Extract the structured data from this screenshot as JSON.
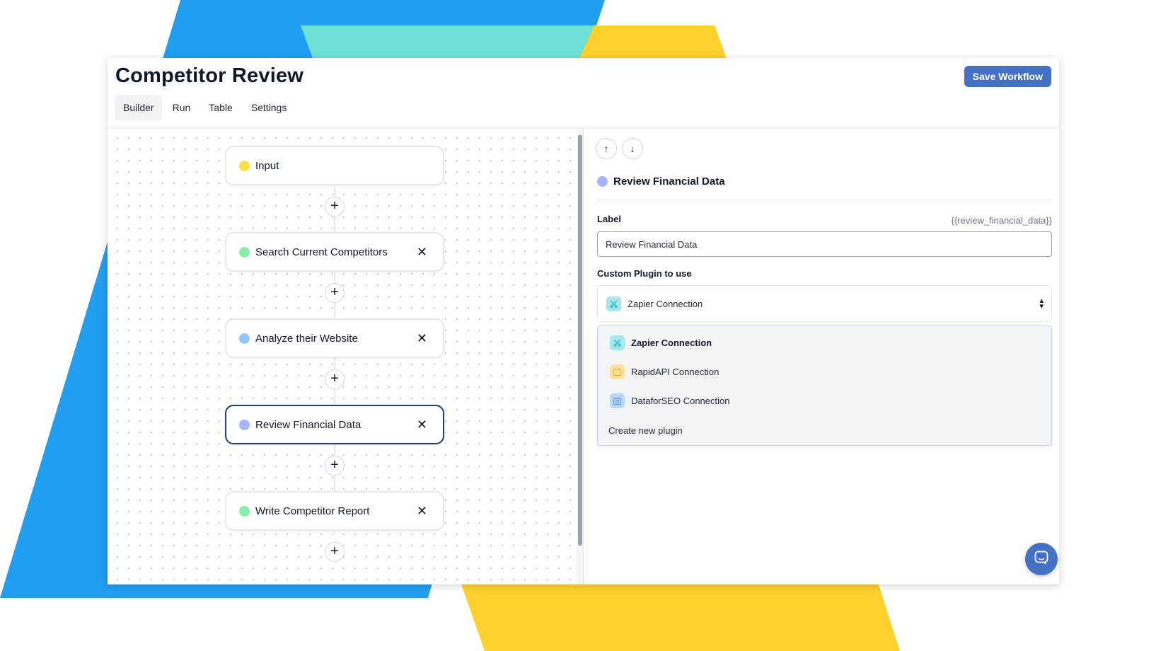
{
  "app": {
    "title": "Competitor Review",
    "save_label": "Save Workflow",
    "tabs": [
      {
        "label": "Builder",
        "active": true
      },
      {
        "label": "Run",
        "active": false
      },
      {
        "label": "Table",
        "active": false
      },
      {
        "label": "Settings",
        "active": false
      }
    ]
  },
  "canvas": {
    "nodes": [
      {
        "label": "Input",
        "color": "#fde047",
        "removable": false,
        "selected": false
      },
      {
        "label": "Search Current Competitors",
        "color": "#86efac",
        "removable": true,
        "selected": false
      },
      {
        "label": "Analyze their Website",
        "color": "#93c5fd",
        "removable": true,
        "selected": false
      },
      {
        "label": "Review Financial Data",
        "color": "#a5b4fc",
        "removable": true,
        "selected": true
      },
      {
        "label": "Write Competitor Report",
        "color": "#86efac",
        "removable": true,
        "selected": false
      }
    ],
    "add_symbol": "+",
    "close_symbol": "✕"
  },
  "panel": {
    "nav_up": "↑",
    "nav_down": "↓",
    "title": "Review Financial Data",
    "title_color": "#a5b4fc",
    "label_field": {
      "label": "Label",
      "variable": "{{review_financial_data}}",
      "value": "Review Financial Data"
    },
    "plugin_field": {
      "label": "Custom Plugin to use",
      "selected": "Zapier Connection",
      "selected_icon": "zapier-icon",
      "options": [
        {
          "label": "Zapier Connection",
          "icon": "zapier-icon",
          "selected": true
        },
        {
          "label": "RapidAPI Connection",
          "icon": "rapidapi-icon",
          "selected": false
        },
        {
          "label": "DataforSEO Connection",
          "icon": "dataforseo-icon",
          "selected": false
        }
      ],
      "create_label": "Create new plugin"
    }
  },
  "colors": {
    "accent": "#4471c4",
    "selected_border": "#1e3a8a"
  }
}
